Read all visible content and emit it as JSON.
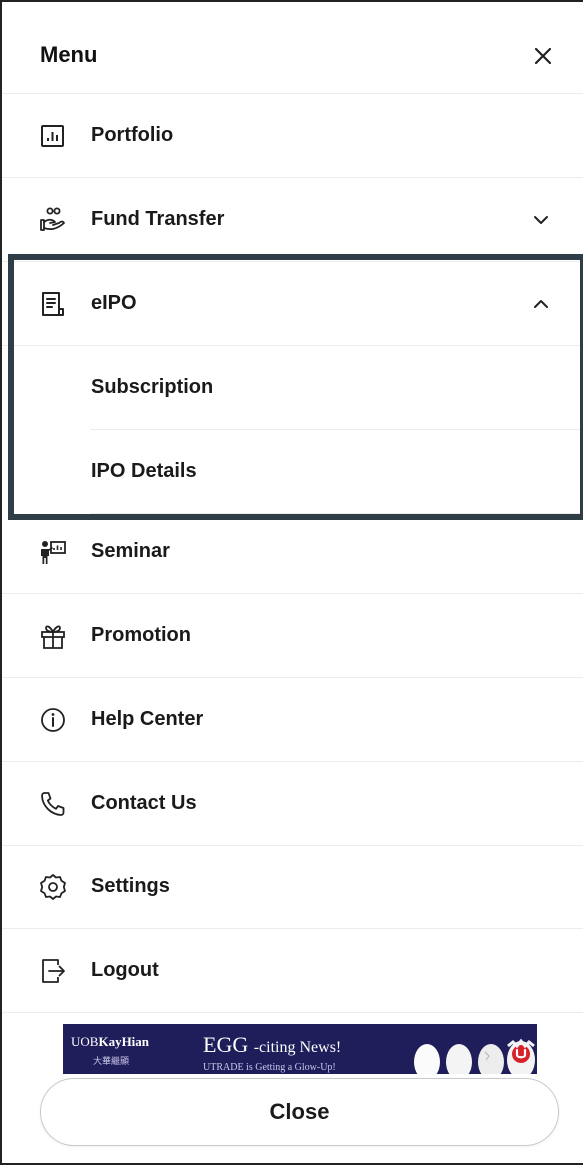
{
  "header": {
    "title": "Menu"
  },
  "menu": {
    "items": [
      {
        "label": "Portfolio",
        "icon": "bar-chart-icon"
      },
      {
        "label": "Fund Transfer",
        "icon": "hand-coins-icon",
        "chevron": "chevron-down-icon"
      },
      {
        "label": "eIPO",
        "icon": "document-icon",
        "chevron": "chevron-up-icon",
        "expanded": true
      },
      {
        "label": "Seminar",
        "icon": "presenter-icon"
      },
      {
        "label": "Promotion",
        "icon": "gift-icon"
      },
      {
        "label": "Help Center",
        "icon": "info-icon"
      },
      {
        "label": "Contact Us",
        "icon": "phone-icon"
      },
      {
        "label": "Settings",
        "icon": "gear-icon"
      },
      {
        "label": "Logout",
        "icon": "logout-icon"
      }
    ],
    "eipo_subitems": [
      {
        "label": "Subscription"
      },
      {
        "label": "IPO Details"
      }
    ]
  },
  "banner": {
    "brand_prefix": "UOB",
    "brand_name": "KayHian",
    "brand_chinese": "大華繼顯",
    "headline_big": "EGG",
    "headline_rest": "-citing News!",
    "subline": "UTRADE is Getting a Glow-Up!",
    "background_color": "#1f1d5a"
  },
  "footer": {
    "close_label": "Close"
  },
  "colors": {
    "highlight_border": "#2f3e46",
    "divider": "#ececec",
    "text": "#1a1a1a"
  }
}
